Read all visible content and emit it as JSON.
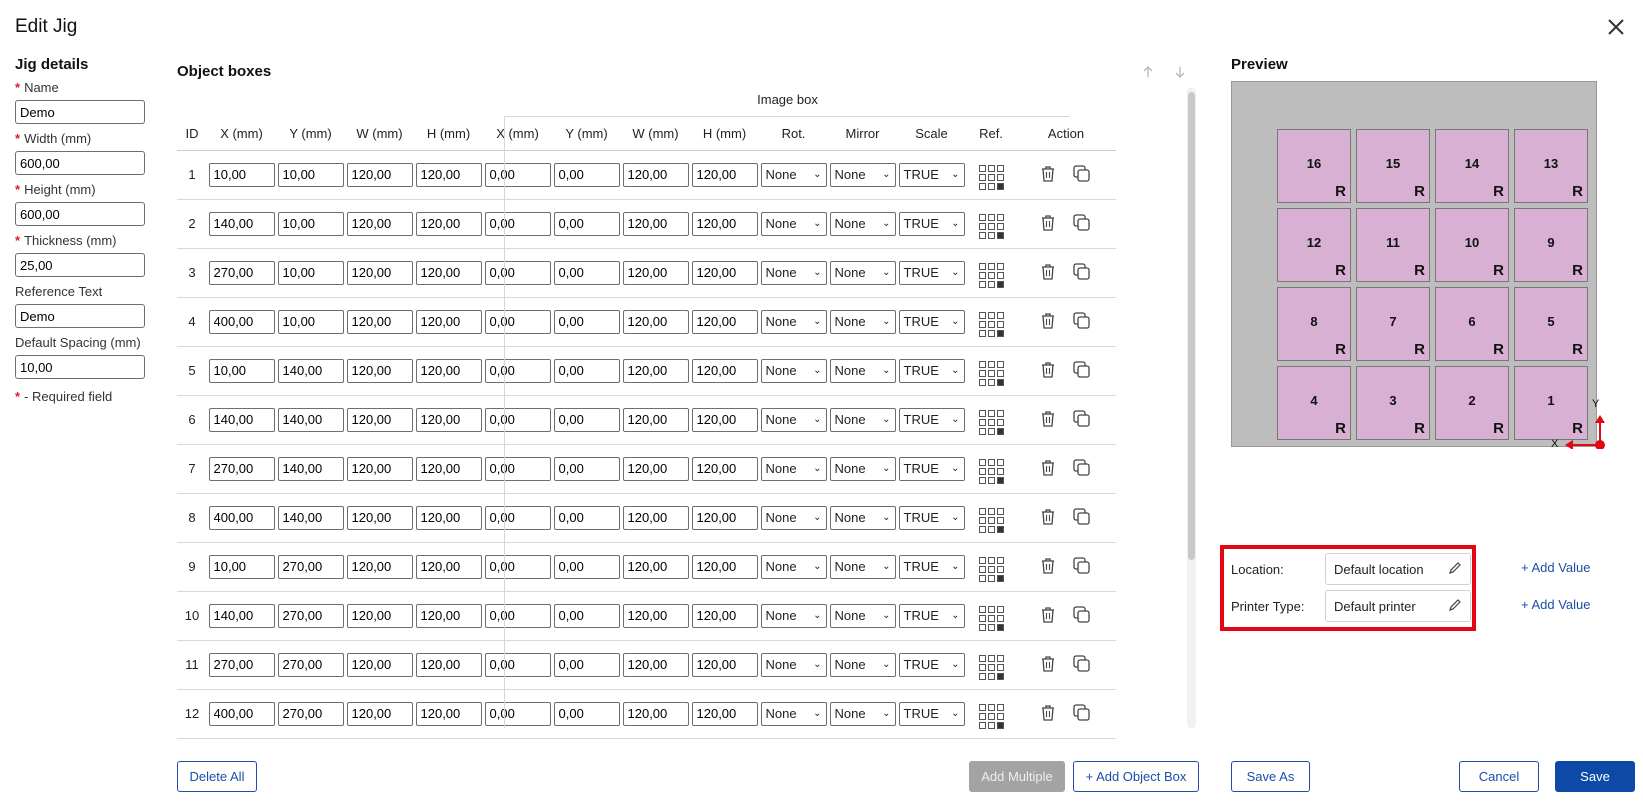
{
  "dialog": {
    "title": "Edit Jig"
  },
  "jig_details": {
    "heading": "Jig details",
    "fields": [
      {
        "label": "Name",
        "required": true,
        "value": "Demo"
      },
      {
        "label": "Width (mm)",
        "required": true,
        "value": "600,00"
      },
      {
        "label": "Height (mm)",
        "required": true,
        "value": "600,00"
      },
      {
        "label": "Thickness (mm)",
        "required": true,
        "value": "25,00"
      },
      {
        "label": "Reference Text",
        "required": false,
        "value": "Demo"
      },
      {
        "label": "Default Spacing (mm)",
        "required": false,
        "value": "10,00"
      }
    ],
    "required_note": "- Required field"
  },
  "object_boxes": {
    "heading": "Object boxes",
    "image_box_label": "Image box",
    "columns": [
      "ID",
      "X (mm)",
      "Y (mm)",
      "W (mm)",
      "H (mm)",
      "X (mm)",
      "Y (mm)",
      "W (mm)",
      "H (mm)",
      "Rot.",
      "Mirror",
      "Scale",
      "Ref.",
      "Action"
    ],
    "rows": [
      {
        "id": "1",
        "x": "10,00",
        "y": "10,00",
        "w": "120,00",
        "h": "120,00",
        "ix": "0,00",
        "iy": "0,00",
        "iw": "120,00",
        "ih": "120,00",
        "rot": "None",
        "mirror": "None",
        "scale": "TRUE"
      },
      {
        "id": "2",
        "x": "140,00",
        "y": "10,00",
        "w": "120,00",
        "h": "120,00",
        "ix": "0,00",
        "iy": "0,00",
        "iw": "120,00",
        "ih": "120,00",
        "rot": "None",
        "mirror": "None",
        "scale": "TRUE"
      },
      {
        "id": "3",
        "x": "270,00",
        "y": "10,00",
        "w": "120,00",
        "h": "120,00",
        "ix": "0,00",
        "iy": "0,00",
        "iw": "120,00",
        "ih": "120,00",
        "rot": "None",
        "mirror": "None",
        "scale": "TRUE"
      },
      {
        "id": "4",
        "x": "400,00",
        "y": "10,00",
        "w": "120,00",
        "h": "120,00",
        "ix": "0,00",
        "iy": "0,00",
        "iw": "120,00",
        "ih": "120,00",
        "rot": "None",
        "mirror": "None",
        "scale": "TRUE"
      },
      {
        "id": "5",
        "x": "10,00",
        "y": "140,00",
        "w": "120,00",
        "h": "120,00",
        "ix": "0,00",
        "iy": "0,00",
        "iw": "120,00",
        "ih": "120,00",
        "rot": "None",
        "mirror": "None",
        "scale": "TRUE"
      },
      {
        "id": "6",
        "x": "140,00",
        "y": "140,00",
        "w": "120,00",
        "h": "120,00",
        "ix": "0,00",
        "iy": "0,00",
        "iw": "120,00",
        "ih": "120,00",
        "rot": "None",
        "mirror": "None",
        "scale": "TRUE"
      },
      {
        "id": "7",
        "x": "270,00",
        "y": "140,00",
        "w": "120,00",
        "h": "120,00",
        "ix": "0,00",
        "iy": "0,00",
        "iw": "120,00",
        "ih": "120,00",
        "rot": "None",
        "mirror": "None",
        "scale": "TRUE"
      },
      {
        "id": "8",
        "x": "400,00",
        "y": "140,00",
        "w": "120,00",
        "h": "120,00",
        "ix": "0,00",
        "iy": "0,00",
        "iw": "120,00",
        "ih": "120,00",
        "rot": "None",
        "mirror": "None",
        "scale": "TRUE"
      },
      {
        "id": "9",
        "x": "10,00",
        "y": "270,00",
        "w": "120,00",
        "h": "120,00",
        "ix": "0,00",
        "iy": "0,00",
        "iw": "120,00",
        "ih": "120,00",
        "rot": "None",
        "mirror": "None",
        "scale": "TRUE"
      },
      {
        "id": "10",
        "x": "140,00",
        "y": "270,00",
        "w": "120,00",
        "h": "120,00",
        "ix": "0,00",
        "iy": "0,00",
        "iw": "120,00",
        "ih": "120,00",
        "rot": "None",
        "mirror": "None",
        "scale": "TRUE"
      },
      {
        "id": "11",
        "x": "270,00",
        "y": "270,00",
        "w": "120,00",
        "h": "120,00",
        "ix": "0,00",
        "iy": "0,00",
        "iw": "120,00",
        "ih": "120,00",
        "rot": "None",
        "mirror": "None",
        "scale": "TRUE"
      },
      {
        "id": "12",
        "x": "400,00",
        "y": "270,00",
        "w": "120,00",
        "h": "120,00",
        "ix": "0,00",
        "iy": "0,00",
        "iw": "120,00",
        "ih": "120,00",
        "rot": "None",
        "mirror": "None",
        "scale": "TRUE"
      }
    ]
  },
  "preview": {
    "heading": "Preview",
    "grid": [
      [
        "16",
        "15",
        "14",
        "13"
      ],
      [
        "12",
        "11",
        "10",
        "9"
      ],
      [
        "8",
        "7",
        "6",
        "5"
      ],
      [
        "4",
        "3",
        "2",
        "1"
      ]
    ],
    "ref_mark": "R",
    "axis_x": "X",
    "axis_y": "Y",
    "box_color": "#d7b0d3",
    "origin_color": "#e30613"
  },
  "meta": {
    "location_label": "Location:",
    "location_value": "Default location",
    "printer_label": "Printer Type:",
    "printer_value": "Default printer",
    "add_value_label": "+ Add Value"
  },
  "buttons": {
    "delete_all": "Delete All",
    "add_multiple": "Add Multiple",
    "add_object_box": "+ Add Object Box",
    "save_as": "Save As",
    "cancel": "Cancel",
    "save": "Save"
  },
  "colors": {
    "accent": "#0d4aa8",
    "highlight_frame": "#e30613"
  }
}
